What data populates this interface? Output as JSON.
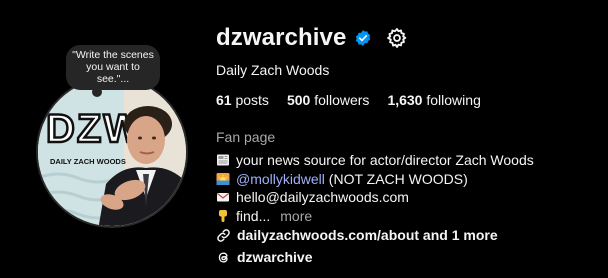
{
  "profile": {
    "username": "dzwarchive",
    "display_name": "Daily Zach Woods",
    "note": "\"Write the scenes you want to see.\"...",
    "avatar": {
      "logo_text": "DZW",
      "logo_subtext": "DAILY ZACH WOODS"
    }
  },
  "stats": {
    "posts_count": "61",
    "posts_label": "posts",
    "followers_count": "500",
    "followers_label": "followers",
    "following_count": "1,630",
    "following_label": "following"
  },
  "category": "Fan page",
  "bio": {
    "line1": "your news source for actor/director Zach Woods",
    "line2_mention": "@mollykidwell",
    "line2_rest": " (NOT ZACH WOODS)",
    "line3": "hello@dailyzachwoods.com",
    "line4": "find...",
    "more_label": "more"
  },
  "links": {
    "website": "dailyzachwoods.com/about and 1 more",
    "threads": "dzwarchive"
  },
  "colors": {
    "background": "#000000",
    "text": "#f5f5f5",
    "secondary": "#a8a8a8",
    "verified_badge": "#0095f6",
    "mention": "#a0aef7"
  },
  "icons": {
    "verified": "verified-badge-icon",
    "settings": "gear-icon",
    "line1": "newspaper-emoji-icon",
    "line2": "sunrise-emoji-icon",
    "line3": "envelope-emoji-icon",
    "line4": "pointing-down-emoji-icon",
    "link": "link-icon",
    "threads": "threads-icon"
  }
}
